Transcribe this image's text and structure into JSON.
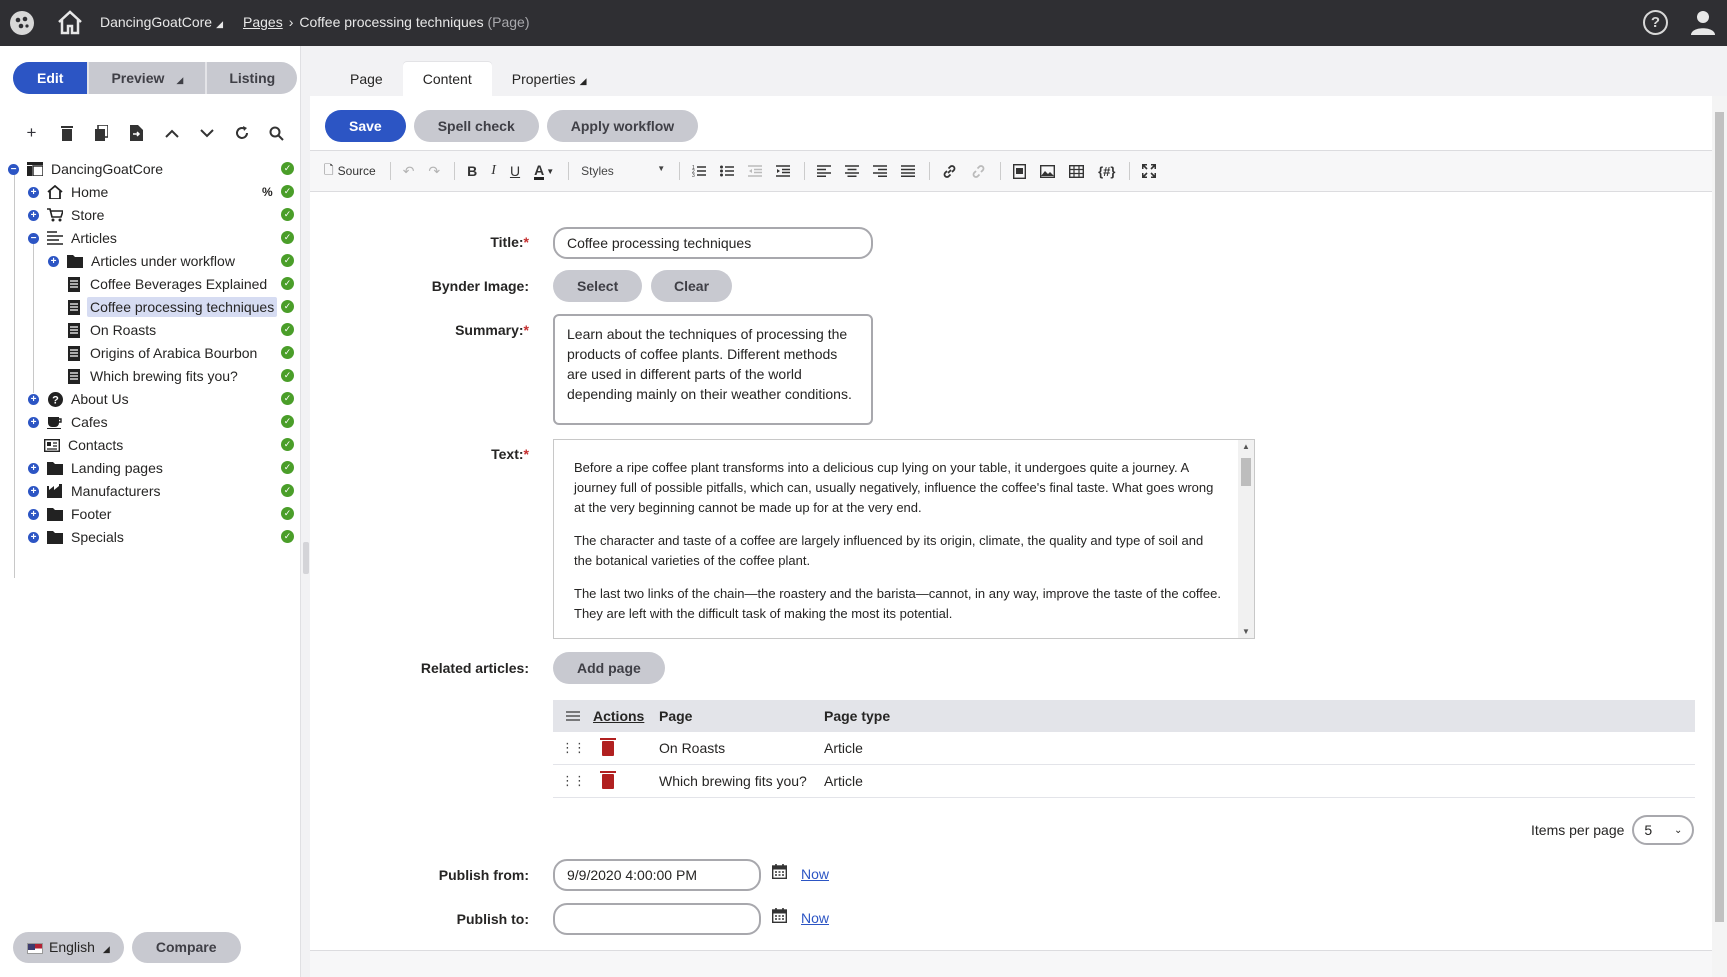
{
  "header": {
    "site_name": "DancingGoatCore",
    "breadcrumb_link": "Pages",
    "breadcrumb_current": "Coffee processing techniques",
    "breadcrumb_suffix": "(Page)"
  },
  "modes": {
    "edit": "Edit",
    "preview": "Preview",
    "listing": "Listing"
  },
  "tree": {
    "root": "DancingGoatCore",
    "items": {
      "home": "Home",
      "store": "Store",
      "articles": "Articles",
      "articles_workflow": "Articles under workflow",
      "coffee_beverages": "Coffee Beverages Explained",
      "coffee_processing": "Coffee processing techniques",
      "on_roasts": "On Roasts",
      "origins": "Origins of Arabica Bourbon",
      "which_brewing": "Which brewing fits you?",
      "about_us": "About Us",
      "cafes": "Cafes",
      "contacts": "Contacts",
      "landing_pages": "Landing pages",
      "manufacturers": "Manufacturers",
      "footer": "Footer",
      "specials": "Specials"
    }
  },
  "bottom_left": {
    "language": "English",
    "compare": "Compare"
  },
  "tabs": {
    "page": "Page",
    "content": "Content",
    "properties": "Properties"
  },
  "actions": {
    "save": "Save",
    "spell_check": "Spell check",
    "apply_workflow": "Apply workflow"
  },
  "editor_toolbar": {
    "source": "Source",
    "styles": "Styles"
  },
  "form": {
    "title_label": "Title:",
    "title_value": "Coffee processing techniques",
    "bynder_label": "Bynder Image:",
    "select_button": "Select",
    "clear_button": "Clear",
    "summary_label": "Summary:",
    "summary_value": "Learn about the techniques of processing the products of coffee plants. Different methods are used in different parts of the world depending mainly on their weather conditions.",
    "text_label": "Text:",
    "text_paragraphs": [
      "Before a ripe coffee plant transforms into a delicious cup lying on your table, it undergoes quite a journey. A journey full of possible pitfalls, which can, usually negatively, influence the coffee's final taste. What goes wrong at the very beginning cannot be made up for at the very end.",
      "The character and taste of a coffee are largely influenced by its origin, climate, the quality and type of soil and the botanical varieties of the coffee plant.",
      "The last two links of the chain—the roastery and the barista—cannot, in any way, improve the taste of the coffee. They are left with the difficult task of making the most its potential."
    ],
    "related_label": "Related articles:",
    "add_page_button": "Add page",
    "grid_headers": {
      "actions": "Actions",
      "page": "Page",
      "page_type": "Page type"
    },
    "grid_rows": [
      {
        "page": "On Roasts",
        "page_type": "Article"
      },
      {
        "page": "Which brewing fits you?",
        "page_type": "Article"
      }
    ],
    "items_per_page_label": "Items per page",
    "items_per_page_value": "5",
    "publish_from_label": "Publish from:",
    "publish_from_value": "9/9/2020 4:00:00 PM",
    "publish_to_label": "Publish to:",
    "publish_to_value": "",
    "now_link": "Now"
  },
  "colors": {
    "primary": "#2c55c4",
    "header_bg": "#2f2f33",
    "success": "#4a9e29",
    "danger": "#b12020"
  }
}
